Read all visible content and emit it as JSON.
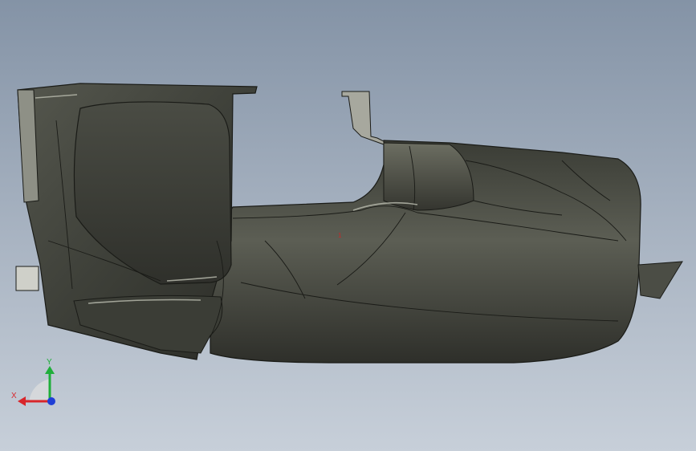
{
  "viewport": {
    "background_top": "#8493a6",
    "background_bottom": "#c7cfd9"
  },
  "model": {
    "body_color": "#3d3f38",
    "shade_color": "#5a5c52",
    "highlight_color": "#9a9c90",
    "edge_color": "#1a1b17",
    "marker_label": "1"
  },
  "triad": {
    "x_label": "X",
    "y_label": "Y",
    "x_color": "#d8262b",
    "y_color": "#1fae3a",
    "z_color": "#1f3fd6",
    "x_icon": "arrow-left-icon",
    "y_icon": "arrow-up-icon",
    "z_icon": "dot-icon"
  }
}
